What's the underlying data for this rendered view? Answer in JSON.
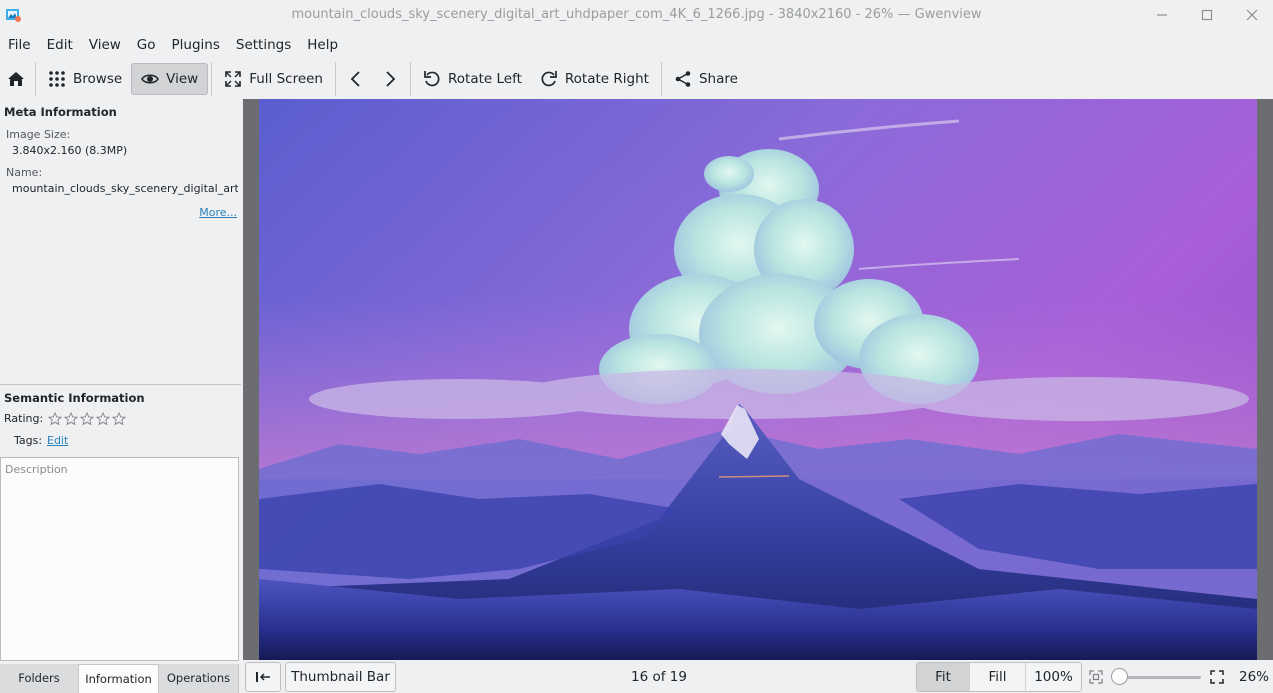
{
  "window": {
    "title": "mountain_clouds_sky_scenery_digital_art_uhdpaper_com_4K_6_1266.jpg - 3840x2160 - 26% — Gwenview",
    "minimize_icon": "minimize-icon",
    "maximize_icon": "maximize-icon",
    "close_icon": "close-icon"
  },
  "menu": [
    "File",
    "Edit",
    "View",
    "Go",
    "Plugins",
    "Settings",
    "Help"
  ],
  "toolbar": {
    "home_icon": "home-icon",
    "browse_label": "Browse",
    "view_label": "View",
    "fullscreen_label": "Full Screen",
    "prev_icon": "chevron-left-icon",
    "next_icon": "chevron-right-icon",
    "rotate_left_label": "Rotate Left",
    "rotate_right_label": "Rotate Right",
    "share_label": "Share"
  },
  "sidebar": {
    "meta_title": "Meta Information",
    "image_size_label": "Image Size:",
    "image_size_value": "3.840x2.160 (8.3MP)",
    "name_label": "Name:",
    "name_value": "mountain_clouds_sky_scenery_digital_art_uhdpaper_com_4K_6_1266.jpg",
    "more_link": "More...",
    "semantic_title": "Semantic Information",
    "rating_label": "Rating:",
    "rating_value": 0,
    "rating_max": 5,
    "tags_label": "Tags:",
    "tags_edit_link": "Edit",
    "description_placeholder": "Description"
  },
  "tabs": {
    "folders": "Folders",
    "information": "Information",
    "operations": "Operations",
    "active": "Information"
  },
  "statusbar": {
    "sidebar_toggle_icon": "collapse-sidebar-icon",
    "thumbnail_bar_label": "Thumbnail Bar",
    "position_text": "16 of 19",
    "fit_label": "Fit",
    "fill_label": "Fill",
    "hundred_label": "100%",
    "zoom_percent": "26%",
    "zoom_fraction": 0.26
  },
  "colors": {
    "accent_link": "#2980b9",
    "active_button_bg": "#d1d3d5",
    "window_bg": "#eff0f1"
  }
}
